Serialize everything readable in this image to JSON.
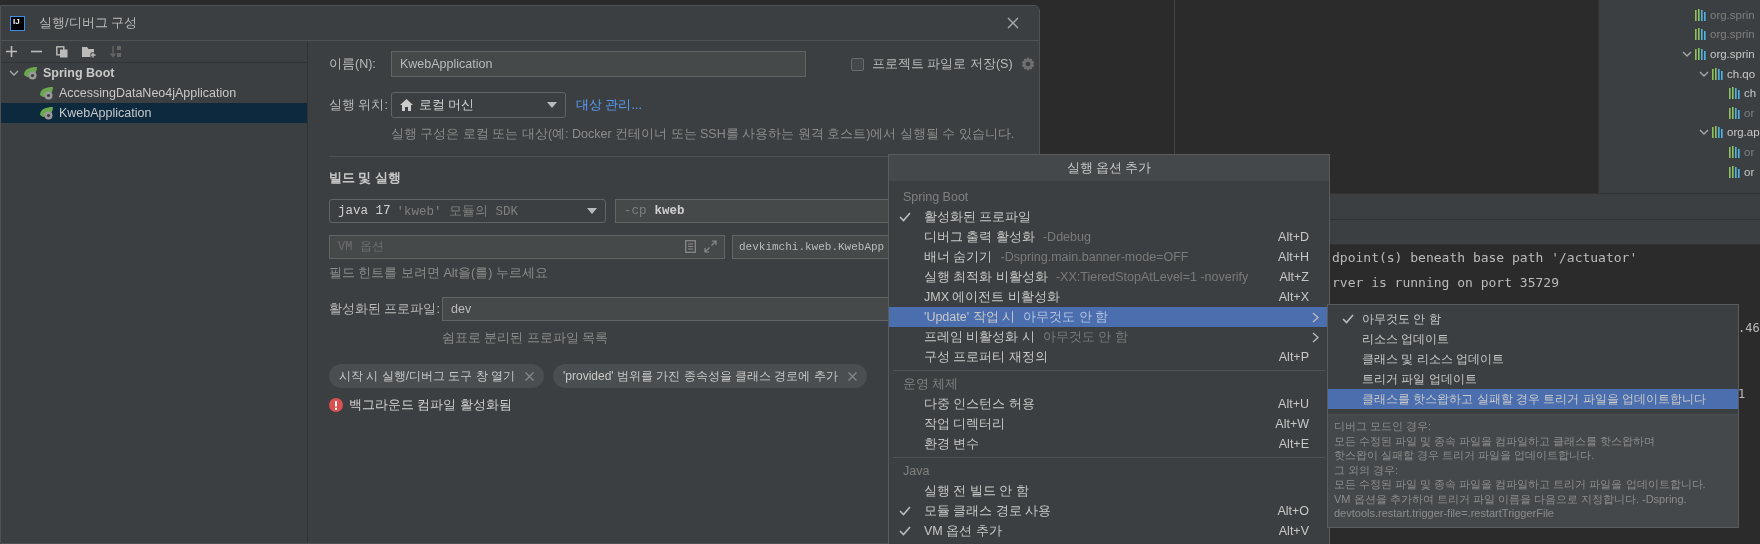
{
  "dialog": {
    "logo_text": "IJ",
    "title": "실행/디버그 구성",
    "tree": [
      {
        "label": "Spring Boot",
        "expanded": true,
        "selected": false,
        "children": [
          {
            "label": "AccessingDataNeo4jApplication",
            "selected": false
          },
          {
            "label": "KwebApplication",
            "selected": true
          }
        ]
      }
    ],
    "name_label": "이름(N):",
    "name_value": "KwebApplication",
    "store_checkbox": {
      "label": "프로젝트 파일로 저장(S)",
      "checked": false
    },
    "run_on_label": "실행 위치:",
    "run_on_value": "로컬 머신",
    "manage_link": "대상 관리...",
    "run_on_hint": "실행 구성은 로컬 또는 대상(예: Docker 컨테이너 또는 SSH를 사용하는 원격 호스트)에서 실행될 수 있습니다.",
    "section_title": "빌드 및 실행",
    "jdk_value": "java 17",
    "jdk_hint": "'kweb' 모듈의 SDK",
    "classpath_prefix": "-cp",
    "classpath_value": "kweb",
    "vm_options": {
      "placeholder": "VM 옵션"
    },
    "main_class": "devkimchi.kweb.KwebApp",
    "field_hint": "필드 힌트를 보려면 Alt을(를) 누르세요",
    "profiles_label": "활성화된 프로파일:",
    "profiles_value": "dev",
    "profiles_hint": "쉼표로 분리된 프로파일 목록",
    "chips": [
      "시작 시 실행/디버그 도구 창 열기",
      "'provided' 범위를 가진 종속성을 클래스 경로에 추가"
    ],
    "warning": "백그라운드 컴파일 활성화됨"
  },
  "popup": {
    "title": "실행 옵션 추가",
    "sections": [
      {
        "title": "Spring Boot",
        "items": [
          {
            "label": "활성화된 프로파일",
            "checked": true,
            "selected": false,
            "submenu": false
          },
          {
            "label": "디버그 출력 활성화",
            "hint": "-Ddebug",
            "shortcut": "Alt+D",
            "checked": false,
            "selected": false,
            "submenu": false
          },
          {
            "label": "배너 숨기기",
            "hint": "-Dspring.main.banner-mode=OFF",
            "shortcut": "Alt+H",
            "checked": false,
            "selected": false,
            "submenu": false
          },
          {
            "label": "실행 최적화 비활성화",
            "hint": "-XX:TieredStopAtLevel=1 -noverify",
            "shortcut": "Alt+Z",
            "checked": false,
            "selected": false,
            "submenu": false
          },
          {
            "label": "JMX 에이전트 비활성화",
            "shortcut": "Alt+X",
            "checked": false,
            "selected": false,
            "submenu": false
          },
          {
            "label": "'Update' 작업 시",
            "hint": "아무것도 안 함",
            "checked": false,
            "selected": true,
            "submenu": true
          },
          {
            "label": "프레임 비활성화 시",
            "hint": "아무것도 안 함",
            "checked": false,
            "selected": false,
            "submenu": true
          },
          {
            "label": "구성 프로퍼티 재정의",
            "shortcut": "Alt+P",
            "checked": false,
            "selected": false,
            "submenu": false
          }
        ]
      },
      {
        "title": "운영 체제",
        "items": [
          {
            "label": "다중 인스턴스 허용",
            "shortcut": "Alt+U",
            "checked": false,
            "selected": false,
            "submenu": false
          },
          {
            "label": "작업 디렉터리",
            "shortcut": "Alt+W",
            "checked": false,
            "selected": false,
            "submenu": false
          },
          {
            "label": "환경 변수",
            "shortcut": "Alt+E",
            "checked": false,
            "selected": false,
            "submenu": false
          }
        ]
      },
      {
        "title": "Java",
        "items": [
          {
            "label": "실행 전 빌드 안 함",
            "checked": false,
            "selected": false,
            "submenu": false
          },
          {
            "label": "모듈 클래스 경로 사용",
            "shortcut": "Alt+O",
            "checked": true,
            "selected": false,
            "submenu": false
          },
          {
            "label": "VM 옵션 추가",
            "shortcut": "Alt+V",
            "checked": true,
            "selected": false,
            "submenu": false
          }
        ]
      }
    ]
  },
  "submenu": {
    "items": [
      {
        "label": "아무것도 안 함",
        "checked": true,
        "selected": false
      },
      {
        "label": "리소스 업데이트",
        "checked": false,
        "selected": false
      },
      {
        "label": "클래스 및 리소스 업데이트",
        "checked": false,
        "selected": false
      },
      {
        "label": "트리거 파일 업데이트",
        "checked": false,
        "selected": false
      },
      {
        "label": "클래스를 핫스왑하고 실패할 경우 트리거 파일을 업데이트합니다",
        "checked": false,
        "selected": true
      }
    ],
    "description": [
      "디버그 모드인 경우:",
      "모든 수정된 파일 및 종속 파일을 컴파일하고 클래스를 핫스왑하며",
      "핫스왑이 실패할 경우 트리거 파일을 업데이트합니다.",
      "그 외의 경우:",
      "모든 수정된 파일 및 종속 파일을 컴파일하고 트리거 파일을 업데이트합니다.",
      "VM 옵션을 추가하여 트리거 파일 이름을 다음으로 지정합니다. -Dspring.",
      "devtools.restart.trigger-file=.restartTriggerFile"
    ]
  },
  "maven": {
    "tree": [
      {
        "label": "org.sprin",
        "dimmed": true
      },
      {
        "label": "org.sprin",
        "dimmed": true
      },
      {
        "label": "org.sprin",
        "dimmed": false,
        "expanded": true,
        "children": [
          {
            "label": "ch.qo",
            "dimmed": false,
            "expanded": true,
            "children": [
              {
                "label": "ch",
                "dimmed": false
              },
              {
                "label": "or",
                "dimmed": true
              }
            ]
          },
          {
            "label": "org.ap",
            "dimmed": false,
            "expanded": true,
            "children": [
              {
                "label": "or",
                "dimmed": true
              },
              {
                "label": "or",
                "dimmed": false
              }
            ]
          }
        ]
      }
    ]
  },
  "console": {
    "lines": [
      "dpoint(s) beneath base path '/actuator'",
      "rver is running on port 35729"
    ],
    "edge_fragments": [
      ".46",
      "1"
    ]
  }
}
